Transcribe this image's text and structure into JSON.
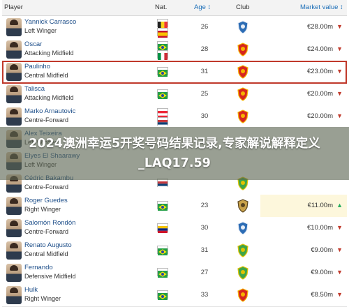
{
  "header": {
    "player": "Player",
    "nat": "Nat.",
    "age": "Age ↕",
    "club": "Club",
    "market_value": "Market value ↕"
  },
  "rows": [
    {
      "name": "Yannick Carrasco",
      "position": "Left Winger",
      "age": "26",
      "value": "€28.00m",
      "trend": "▼",
      "flags": [
        "be",
        "es"
      ],
      "club": "blue-crest-icon"
    },
    {
      "name": "Oscar",
      "position": "Attacking Midfield",
      "age": "28",
      "value": "€24.00m",
      "trend": "▼",
      "flags": [
        "br",
        "it"
      ],
      "club": "red-crest-icon"
    },
    {
      "name": "Paulinho",
      "position": "Central Midfield",
      "age": "31",
      "value": "€23.00m",
      "trend": "▼",
      "flags": [
        "br"
      ],
      "club": "red-crest-icon"
    },
    {
      "name": "Talisca",
      "position": "Attacking Midfield",
      "age": "25",
      "value": "€20.00m",
      "trend": "▼",
      "flags": [
        "br"
      ],
      "club": "red-crest-icon"
    },
    {
      "name": "Marko Arnautovic",
      "position": "Centre-Forward",
      "age": "30",
      "value": "€20.00m",
      "trend": "▼",
      "flags": [
        "at",
        "rs"
      ],
      "club": "red-crest-icon"
    },
    {
      "name": "Alex Teixeira",
      "position": "Left Winger",
      "age": "",
      "value": "",
      "trend": "",
      "flags": [],
      "club": ""
    },
    {
      "name": "Elyes El Shaarawy",
      "position": "Left Winger",
      "age": "",
      "value": "",
      "trend": "",
      "flags": [],
      "club": ""
    },
    {
      "name": "Cédric Bakambu",
      "position": "Centre-Forward",
      "age": "",
      "value": "",
      "trend": "",
      "flags": [
        "rs"
      ],
      "club": "green-crest-icon"
    },
    {
      "name": "Roger Guedes",
      "position": "Right Winger",
      "age": "23",
      "value": "€11.00m",
      "trend": "▲",
      "flags": [
        "br"
      ],
      "club": "gold-crest-icon"
    },
    {
      "name": "Salomón Rondón",
      "position": "Centre-Forward",
      "age": "30",
      "value": "€10.00m",
      "trend": "▼",
      "flags": [
        "ve"
      ],
      "club": "blue-crest-icon"
    },
    {
      "name": "Renato Augusto",
      "position": "Central Midfield",
      "age": "31",
      "value": "€9.00m",
      "trend": "▼",
      "flags": [
        "br"
      ],
      "club": "green-crest-icon"
    },
    {
      "name": "Fernando",
      "position": "Defensive Midfield",
      "age": "27",
      "value": "€9.00m",
      "trend": "▼",
      "flags": [
        "br"
      ],
      "club": "green-crest-icon"
    },
    {
      "name": "Hulk",
      "position": "Right Winger",
      "age": "33",
      "value": "€8.50m",
      "trend": "▼",
      "flags": [
        "br"
      ],
      "club": "red-crest-icon"
    }
  ],
  "watermark": "2024澳洲幸运5开奖号码结果记录,专家解说解释定义_LAQ17.59",
  "colors": {
    "link": "#1d4e89",
    "down": "#c0392b",
    "up": "#27ae60",
    "highlight_border": "#c0392b",
    "value_up_bg": "#fdf7dc"
  }
}
